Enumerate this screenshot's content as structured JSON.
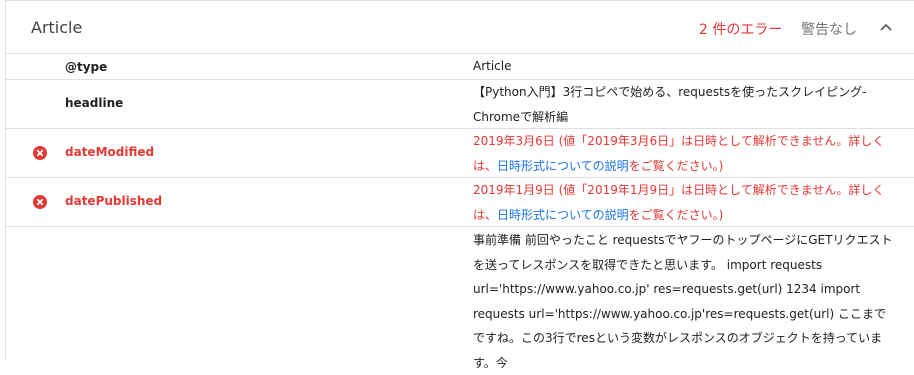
{
  "header": {
    "title": "Article",
    "errors": "2 件のエラー",
    "warnings": "警告なし"
  },
  "rows": [
    {
      "key": "@type",
      "value": "Article"
    },
    {
      "key": "headline",
      "value": "【Python入門】3行コピペで始める、requestsを使ったスクレイピング-Chromeで解析編"
    },
    {
      "key": "dateModified",
      "value_pre": "2019年3月6日 (値「2019年3月6日」は日時として解析できません。詳しくは、",
      "value_link": "日時形式についての説明",
      "value_post": "をご覧ください。)"
    },
    {
      "key": "datePublished",
      "value_pre": "2019年1月9日 (値「2019年1月9日」は日時として解析できません。詳しくは、",
      "value_link": "日時形式についての説明",
      "value_post": "をご覧ください。)"
    },
    {
      "key": "",
      "value": "事前準備 前回やったこと requestsでヤフーのトップページにGETリクエストを送ってレスポンスを取得できたと思います。 import requests url='https://www.yahoo.co.jp' res=requests.get(url) 1234 import requests url='https://www.yahoo.co.jp'res=requests.get(url) ここまでですね。この3行でresという変数がレスポンスのオブジェクトを持っています。今"
    }
  ],
  "colors": {
    "error": "#e53935",
    "link": "#1a73e8",
    "muted": "#757575"
  },
  "icons": {
    "collapse": "chevron-up-icon",
    "error": "error-circle-icon"
  }
}
